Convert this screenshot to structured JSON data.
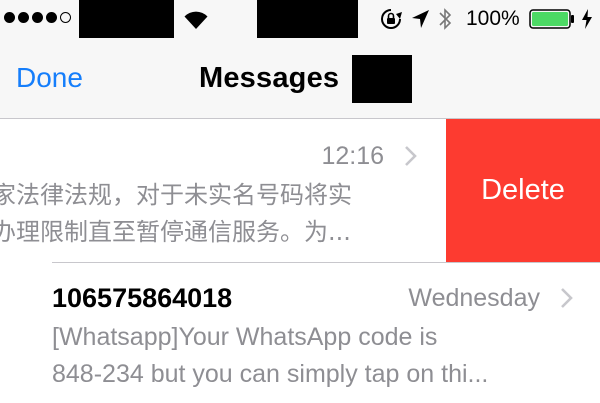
{
  "status_bar": {
    "battery_percent": "100%",
    "signal_bars_filled": 4,
    "signal_bars_total": 5,
    "battery_level": 1.0,
    "battery_color": "#4cd964",
    "icons": [
      "wifi-icon",
      "orientation-lock-icon",
      "location-arrow-icon",
      "bluetooth-icon",
      "battery-icon",
      "charging-icon"
    ]
  },
  "nav": {
    "done_label": "Done",
    "title": "Messages",
    "accent_color": "#157efb"
  },
  "conversations": [
    {
      "time": "12:16",
      "preview_lines": [
        "家法律法规，对于未实名号码将实",
        "办理限制直至暂停通信服务。为..."
      ],
      "delete_label": "Delete",
      "delete_color": "#fd3b30"
    },
    {
      "sender": "106575864018",
      "time": "Wednesday",
      "preview_lines": [
        "[Whatsapp]Your WhatsApp code is",
        "848-234 but you can simply tap on thi..."
      ]
    }
  ]
}
